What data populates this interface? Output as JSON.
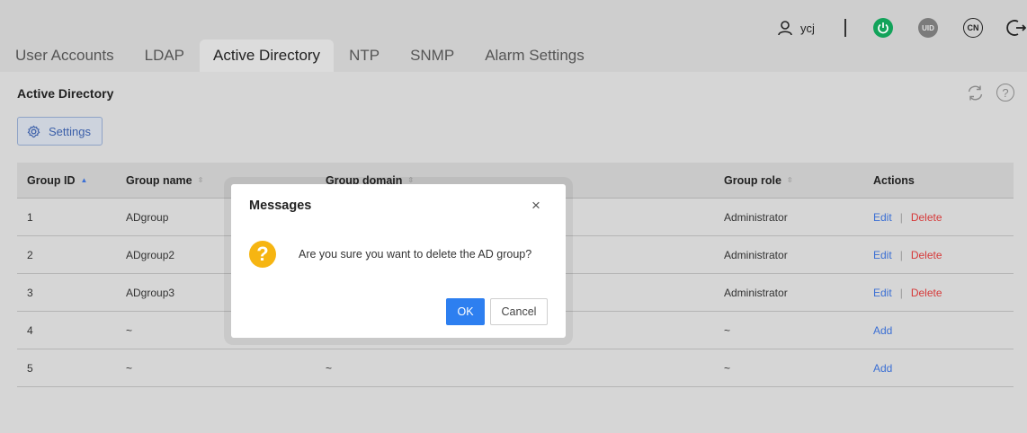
{
  "header": {
    "username": "ycj",
    "icons": [
      "user-icon",
      "power-icon",
      "uid-icon",
      "language-icon",
      "logout-icon"
    ],
    "uid_label": "UID",
    "language_label": "CN",
    "colors": {
      "power": "#12a35a",
      "uid": "#7b7b7b"
    }
  },
  "tabs": [
    {
      "label": "User Accounts"
    },
    {
      "label": "LDAP"
    },
    {
      "label": "Active Directory",
      "active": true
    },
    {
      "label": "NTP"
    },
    {
      "label": "SNMP"
    },
    {
      "label": "Alarm Settings"
    }
  ],
  "page": {
    "title": "Active Directory",
    "settings_label": "Settings",
    "help_glyph": "?"
  },
  "table": {
    "columns": [
      "Group ID",
      "Group name",
      "Group domain",
      "Group role",
      "Actions"
    ],
    "rows": [
      {
        "id": "1",
        "name": "ADgroup",
        "domain": "",
        "role": "Administrator",
        "actions": [
          "Edit",
          "Delete"
        ]
      },
      {
        "id": "2",
        "name": "ADgroup2",
        "domain": "",
        "role": "Administrator",
        "actions": [
          "Edit",
          "Delete"
        ]
      },
      {
        "id": "3",
        "name": "ADgroup3",
        "domain": "",
        "role": "Administrator",
        "actions": [
          "Edit",
          "Delete"
        ]
      },
      {
        "id": "4",
        "name": "~",
        "domain": "",
        "role": "~",
        "actions": [
          "Add"
        ]
      },
      {
        "id": "5",
        "name": "~",
        "domain": "~",
        "role": "~",
        "actions": [
          "Add"
        ]
      }
    ],
    "separator": "|"
  },
  "dialog": {
    "title": "Messages",
    "close_glyph": "×",
    "icon_glyph": "?",
    "message": "Are you sure you want to delete the AD group?",
    "ok_label": "OK",
    "cancel_label": "Cancel",
    "colors": {
      "ok": "#2d7ff0",
      "icon": "#f6b512"
    }
  }
}
